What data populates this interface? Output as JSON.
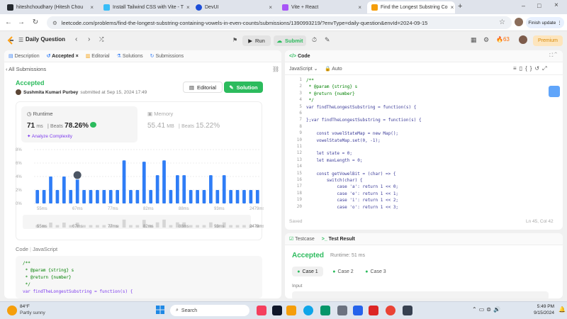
{
  "browser": {
    "tabs": [
      {
        "title": "hiteshchoudhary (Hitesh Chou",
        "color": "#24292f",
        "active": false
      },
      {
        "title": "Install Tailwind CSS with Vite - T",
        "color": "#38bdf8",
        "active": false
      },
      {
        "title": "DevUI",
        "color": "#1d4ed8",
        "active": false
      },
      {
        "title": "Vite + React",
        "color": "#a855f7",
        "active": false
      },
      {
        "title": "Find the Longest Substring Co",
        "color": "#f59e0b",
        "active": true
      }
    ],
    "url": "leetcode.com/problems/find-the-longest-substring-containing-vowels-in-even-counts/submissions/1390993219/?envType=daily-question&envId=2024-09-15",
    "finish_update": "Finish update"
  },
  "lc_header": {
    "title": "Daily Question",
    "run": "Run",
    "submit": "Submit",
    "streak": "63",
    "premium": "Premium"
  },
  "left_panel": {
    "tabs": [
      "Description",
      "Accepted",
      "Editorial",
      "Solutions",
      "Submissions"
    ],
    "all_submissions": "All Submissions",
    "status": "Accepted",
    "author": "Sushmita Kumari Purbey",
    "submitted_at": "submitted at Sep 15, 2024 17:49",
    "editorial_btn": "Editorial",
    "solution_btn": "Solution",
    "runtime": {
      "label": "Runtime",
      "value": "71",
      "unit": "ms",
      "beats_label": "Beats",
      "beats": "78.26%",
      "analyze": "Analyze Complexity"
    },
    "memory": {
      "label": "Memory",
      "value": "55.41",
      "unit": "MB",
      "beats_label": "Beats",
      "beats": "15.22%"
    },
    "code_label": "Code",
    "code_lang": "JavaScript",
    "code_preview": [
      "/**",
      " * @param {string} s",
      " * @return {number}",
      " */",
      "var findTheLongestSubstring = function(s) {"
    ]
  },
  "chart_data": {
    "type": "bar",
    "ylabels": [
      "8%",
      "6%",
      "4%",
      "2%",
      "0%"
    ],
    "xlabels": [
      "55ms",
      "67ms",
      "77ms",
      "82ms",
      "88ms",
      "93ms",
      "2479ms"
    ],
    "values": [
      2,
      2,
      4,
      2,
      4,
      2,
      4,
      2,
      2,
      2,
      2,
      2,
      2,
      6.4,
      2,
      2,
      6.2,
      2,
      4.2,
      6.4,
      2,
      4.2,
      4.2,
      2,
      2,
      2,
      4.2,
      2,
      4.2,
      2,
      2,
      2,
      2,
      2
    ],
    "highlight_index": 6,
    "bar_color": "#2f7df6",
    "ylim": [
      0,
      8
    ]
  },
  "code_panel": {
    "title": "Code",
    "language": "JavaScript",
    "mode": "Auto",
    "saved": "Saved",
    "cursor": "Ln 45, Col 42",
    "lines": [
      "/**",
      " * @param {string} s",
      " * @return {number}",
      " */",
      "var findTheLongestSubstring = function(s) {",
      "",
      "};var findTheLongestSubstring = function(s) {",
      "",
      "    const vowelStateMap = new Map();",
      "    vowelStateMap.set(0, -1);",
      "",
      "    let state = 0;",
      "    let maxLength = 0;",
      "",
      "    const getVowelBit = (char) => {",
      "        switch(char) {",
      "            case 'a': return 1 << 0;",
      "            case 'e': return 1 << 1;",
      "            case 'i': return 1 << 2;",
      "            case 'o': return 1 << 3;"
    ]
  },
  "result_panel": {
    "tabs": [
      "Testcase",
      "Test Result"
    ],
    "status": "Accepted",
    "runtime": "Runtime: 51 ms",
    "cases": [
      "Case 1",
      "Case 2",
      "Case 3"
    ],
    "input_label": "Input"
  },
  "taskbar": {
    "temp": "84°F",
    "weather": "Partly sunny",
    "search": "Search",
    "time": "5:49 PM",
    "date": "9/15/2024"
  }
}
